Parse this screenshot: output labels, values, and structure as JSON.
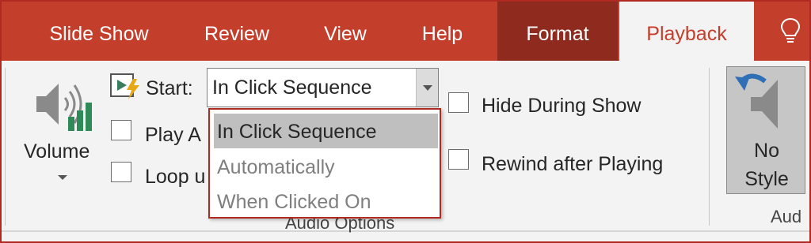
{
  "tabs": [
    {
      "label": "Slide Show",
      "state": "normal"
    },
    {
      "label": "Review",
      "state": "normal"
    },
    {
      "label": "View",
      "state": "normal"
    },
    {
      "label": "Help",
      "state": "normal"
    },
    {
      "label": "Format",
      "state": "contextual"
    },
    {
      "label": "Playback",
      "state": "active"
    }
  ],
  "colors": {
    "accent": "#c43e2c",
    "contextual": "#8e2b1e",
    "ribbon_bg": "#f3f3f3"
  },
  "icons": {
    "tell_me": "lightbulb-icon",
    "volume": "speaker-volume-icon",
    "start": "animation-start-icon",
    "no_style": "speaker-undo-icon"
  },
  "volume": {
    "label": "Volume"
  },
  "start": {
    "label": "Start:",
    "value": "In Click Sequence",
    "options": [
      "In Click Sequence",
      "Automatically",
      "When Clicked On"
    ],
    "highlighted_option": "In Click Sequence"
  },
  "checkboxes": {
    "play_across": {
      "label": "Play A",
      "checked": false
    },
    "loop": {
      "label": "Loop u",
      "checked": false
    },
    "hide_during_show": {
      "label": "Hide During Show",
      "checked": false
    },
    "rewind": {
      "label": "Rewind after Playing",
      "checked": false
    }
  },
  "groups": {
    "audio_options": "Audio Options",
    "audio_styles": "Aud"
  },
  "no_style": {
    "line1": "No",
    "line2": "Style"
  }
}
